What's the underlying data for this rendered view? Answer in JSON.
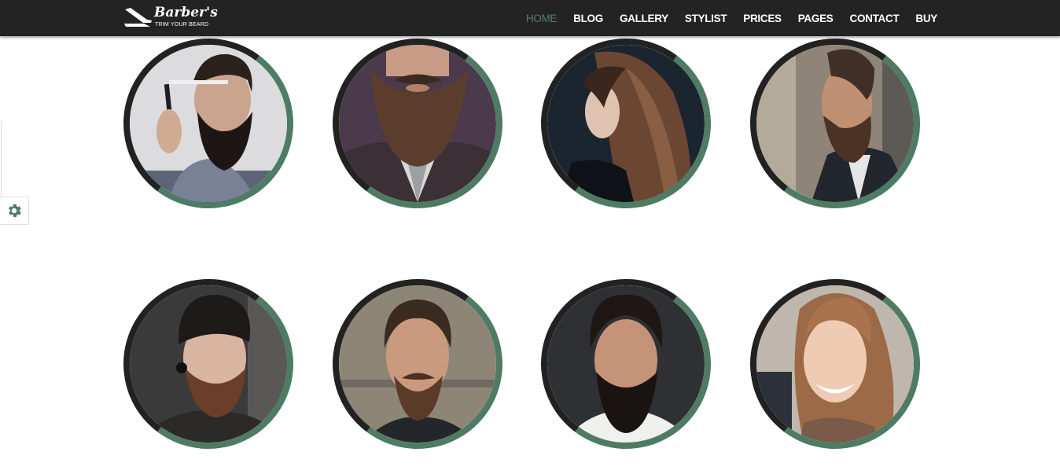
{
  "header": {
    "logo": {
      "brand": "Barber's",
      "tagline": "TRIM YOUR BEARD",
      "icon": "razor-icon"
    },
    "nav": [
      {
        "label": "HOME",
        "active": true
      },
      {
        "label": "BLOG",
        "active": false
      },
      {
        "label": "GALLERY",
        "active": false
      },
      {
        "label": "STYLIST",
        "active": false
      },
      {
        "label": "PRICES",
        "active": false
      },
      {
        "label": "PAGES",
        "active": false
      },
      {
        "label": "CONTACT",
        "active": false
      },
      {
        "label": "BUY",
        "active": false
      }
    ]
  },
  "settings": {
    "icon": "gear-icon"
  },
  "colors": {
    "navbar_bg": "#232323",
    "accent_green": "#4e7b63",
    "ring_dark": "#222222",
    "page_bg": "#ffffff"
  },
  "gallery": {
    "items": [
      {
        "subject": "bearded man holding straight razor"
      },
      {
        "subject": "bearded man with mustache in striped shirt"
      },
      {
        "subject": "woman with long brown hair in profile"
      },
      {
        "subject": "bearded man in side profile"
      },
      {
        "subject": "bearded man in beanie with earring"
      },
      {
        "subject": "man with mustache and beard"
      },
      {
        "subject": "bearded man in white t-shirt"
      },
      {
        "subject": "smiling woman with long hair"
      }
    ]
  }
}
